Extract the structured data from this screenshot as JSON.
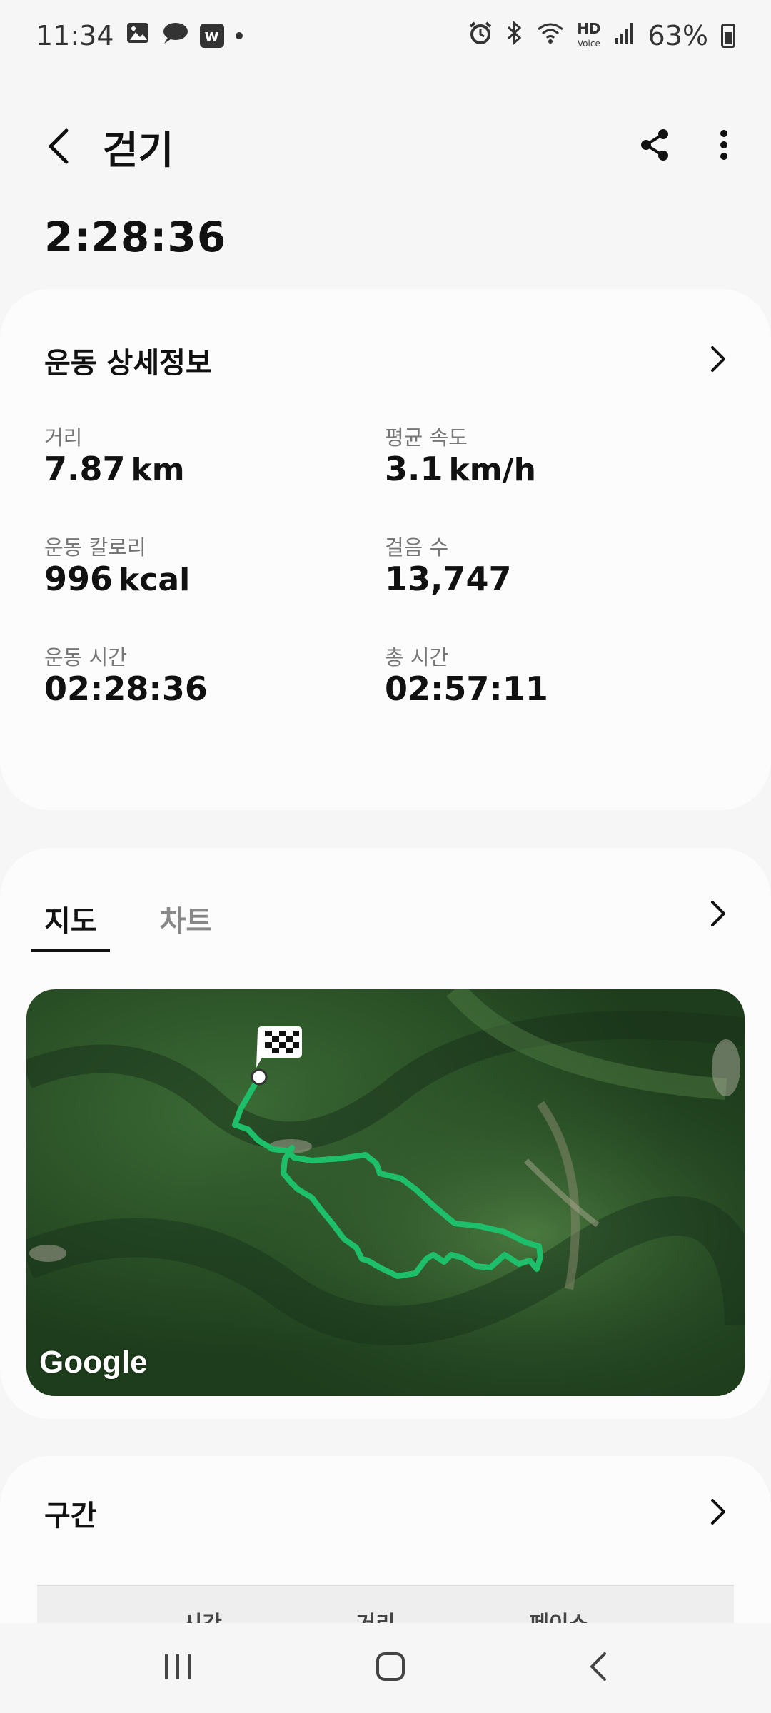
{
  "status_bar": {
    "time": "11:34",
    "left_icons": [
      "image-icon",
      "chat-icon",
      "w-app-icon",
      "dot-icon"
    ],
    "right_icons": [
      "alarm-icon",
      "bluetooth-icon",
      "wifi-icon",
      "hd-voice-icon",
      "signal-icon"
    ],
    "hd_label": "HD",
    "battery": "63%"
  },
  "header": {
    "title": "걷기",
    "duration": "2:28:36"
  },
  "details": {
    "title": "운동 상세정보",
    "stats": [
      {
        "label": "거리",
        "value": "7.87",
        "unit": "km"
      },
      {
        "label": "평균 속도",
        "value": "3.1",
        "unit": "km/h"
      },
      {
        "label": "운동 칼로리",
        "value": "996",
        "unit": "kcal"
      },
      {
        "label": "걸음 수",
        "value": "13,747",
        "unit": ""
      },
      {
        "label": "운동 시간",
        "value": "02:28:36",
        "unit": ""
      },
      {
        "label": "총 시간",
        "value": "02:57:11",
        "unit": ""
      }
    ]
  },
  "map_card": {
    "tabs": [
      {
        "label": "지도",
        "active": true
      },
      {
        "label": "차트",
        "active": false
      }
    ],
    "attribution": "Google",
    "route_color": "#1dbf6a"
  },
  "sections": {
    "title": "구간",
    "columns": [
      "시간",
      "거리",
      "페이스"
    ]
  },
  "nav": {
    "icons": [
      "recent-apps-icon",
      "home-icon",
      "back-nav-icon"
    ]
  }
}
